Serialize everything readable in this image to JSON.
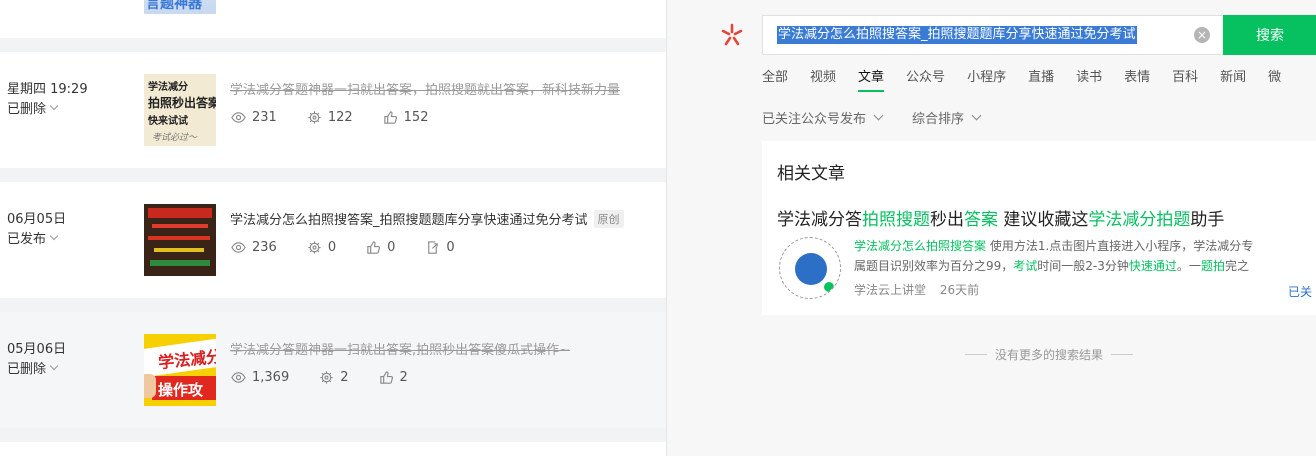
{
  "top_card": {
    "thumb_text": "言题神器"
  },
  "articles": [
    {
      "date": "星期四 19:29",
      "status": "已删除",
      "title": "学法减分答题神器一扫就出答案，拍照搜题就出答案，新科技新力量",
      "struck": true,
      "tag": "",
      "thumb": {
        "line1": "学法减分",
        "line2": "拍照秒出答案",
        "line3": "快来试试",
        "line4": "考试必过～"
      },
      "stats": [
        {
          "icon": "eye-icon",
          "value": "231"
        },
        {
          "icon": "gear-icon",
          "value": "122"
        },
        {
          "icon": "thumb-up-icon",
          "value": "152"
        }
      ]
    },
    {
      "date": "06月05日",
      "status": "已发布",
      "title": "学法减分怎么拍照搜答案_拍照搜题题库分享快速通过免分考试",
      "struck": false,
      "tag": "原创",
      "stats": [
        {
          "icon": "eye-icon",
          "value": "236"
        },
        {
          "icon": "gear-icon",
          "value": "0"
        },
        {
          "icon": "thumb-up-icon",
          "value": "0"
        },
        {
          "icon": "share-icon",
          "value": "0"
        }
      ]
    },
    {
      "date": "05月06日",
      "status": "已删除",
      "title": "学法减分答题神器一扫就出答案,拍照秒出答案傻瓜式操作~",
      "struck": true,
      "tag": "",
      "thumb": {
        "line1": "学法减分",
        "line2": "操作攻"
      },
      "stats": [
        {
          "icon": "eye-icon",
          "value": "1,369"
        },
        {
          "icon": "gear-icon",
          "value": "2"
        },
        {
          "icon": "thumb-up-icon",
          "value": "2"
        }
      ]
    }
  ],
  "search": {
    "query": "学法减分怎么拍照搜答案_拍照搜题题库分享快速通过免分考试",
    "clear_icon": "close-circle-icon",
    "button_label": "搜索",
    "logo_icon": "wechat-search-logo-icon",
    "brand_color": "#07c160"
  },
  "tabs": [
    {
      "label": "全部",
      "active": false
    },
    {
      "label": "视频",
      "active": false
    },
    {
      "label": "文章",
      "active": true
    },
    {
      "label": "公众号",
      "active": false
    },
    {
      "label": "小程序",
      "active": false
    },
    {
      "label": "直播",
      "active": false
    },
    {
      "label": "读书",
      "active": false
    },
    {
      "label": "表情",
      "active": false
    },
    {
      "label": "百科",
      "active": false
    },
    {
      "label": "新闻",
      "active": false
    },
    {
      "label": "微",
      "active": false
    }
  ],
  "filters": [
    {
      "label": "已关注公众号发布"
    },
    {
      "label": "综合排序"
    }
  ],
  "results": {
    "heading": "相关文章",
    "item": {
      "title_parts": [
        {
          "text": "学法减分答",
          "hl": false
        },
        {
          "text": "拍照搜题",
          "hl": true
        },
        {
          "text": "秒出",
          "hl": false
        },
        {
          "text": "答案",
          "hl": true
        },
        {
          "text": " 建议收藏这",
          "hl": false
        },
        {
          "text": "学法减分拍题",
          "hl": true
        },
        {
          "text": "助手",
          "hl": false
        }
      ],
      "snippet_line1": [
        {
          "text": "学法减分怎么拍照搜答案",
          "hl": true
        },
        {
          "text": " 使用方法1.点击图片直接进入小程序，学法减分专",
          "hl": false
        }
      ],
      "snippet_line2": [
        {
          "text": "属题目识别效率为百分之99，",
          "hl": false
        },
        {
          "text": "考试",
          "hl": true
        },
        {
          "text": "时间一般2-3分钟",
          "hl": false
        },
        {
          "text": "快速通过",
          "hl": true
        },
        {
          "text": "。一",
          "hl": false
        },
        {
          "text": "题拍",
          "hl": true
        },
        {
          "text": "完之",
          "hl": false
        }
      ],
      "source": "学法云上讲堂",
      "time": "26天前",
      "follow_label": "已关"
    },
    "no_more": "没有更多的搜索结果"
  }
}
